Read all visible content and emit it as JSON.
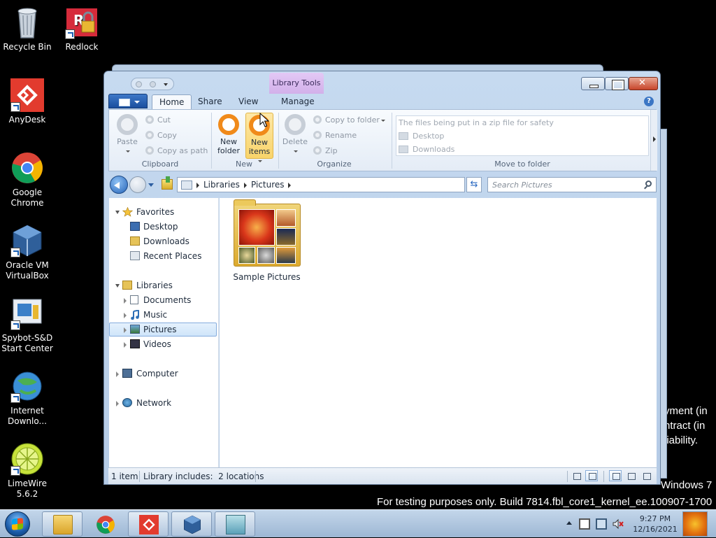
{
  "desktop": {
    "icons": [
      {
        "label": "Recycle Bin"
      },
      {
        "label": "Redlock"
      },
      {
        "label": "AnyDesk"
      },
      {
        "label": "Google Chrome"
      },
      {
        "label": "Oracle VM VirtualBox"
      },
      {
        "label": "Spybot-S&D Start Center"
      },
      {
        "label": "Internet Downlo..."
      },
      {
        "label": "LimeWire 5.6.2"
      }
    ],
    "watermark": {
      "line1": "yment (in",
      "line2": "ntract (in",
      "line3": "liability.",
      "line4": "Windows 7",
      "line5": "For testing purposes only. Build 7814.fbl_core1_kernel_ee.100907-1700"
    }
  },
  "window": {
    "context_tab": "Library Tools",
    "tabs": [
      "Home",
      "Share",
      "View",
      "Manage"
    ],
    "active_tab": "Home"
  },
  "ribbon": {
    "clipboard": {
      "paste": "Paste",
      "cut": "Cut",
      "copy": "Copy",
      "copy_as_path": "Copy as path",
      "label": "Clipboard"
    },
    "new": {
      "new_folder_line1": "New",
      "new_folder_line2": "folder",
      "new_items_line1": "New",
      "new_items_line2": "items",
      "label": "New"
    },
    "organize": {
      "delete": "Delete",
      "copy_to_folder": "Copy to folder",
      "rename": "Rename",
      "zip": "Zip",
      "label": "Organize"
    },
    "move_to_folder": {
      "items": [
        "The files being put in a zip file for safety",
        "Desktop",
        "Downloads"
      ],
      "label": "Move to folder"
    }
  },
  "address": {
    "crumbs": [
      "Libraries",
      "Pictures"
    ],
    "search_placeholder": "Search Pictures"
  },
  "nav": {
    "favorites": "Favorites",
    "favorites_items": [
      "Desktop",
      "Downloads",
      "Recent Places"
    ],
    "libraries": "Libraries",
    "libraries_items": [
      "Documents",
      "Music",
      "Pictures",
      "Videos"
    ],
    "computer": "Computer",
    "network": "Network"
  },
  "files": [
    {
      "name": "Sample Pictures"
    }
  ],
  "status": {
    "count": "1 item",
    "library_info": "Library includes:  2 locations"
  },
  "taskbar": {
    "clock_time": "9:27 PM",
    "clock_date": "12/16/2021"
  }
}
